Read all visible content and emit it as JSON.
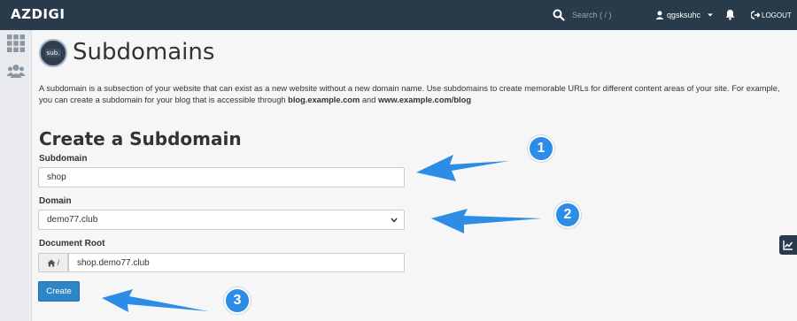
{
  "topbar": {
    "brand": "AZDIGI",
    "search_placeholder": "Search ( / )",
    "username": "qgsksuhc",
    "logout_label": "LOGOUT"
  },
  "header": {
    "logo_text": "sub.",
    "title": "Subdomains"
  },
  "description": {
    "text_1": "A subdomain is a subsection of your website that can exist as a new website without a new domain name. Use subdomains to create memorable URLs for different content areas of your site. For example, you can create a subdomain for your blog that is accessible through ",
    "example_1": "blog.example.com",
    "text_2": " and ",
    "example_2": "www.example.com/blog"
  },
  "form": {
    "title": "Create a Subdomain",
    "subdomain_label": "Subdomain",
    "subdomain_value": "shop",
    "domain_label": "Domain",
    "domain_value": "demo77.club",
    "docroot_label": "Document Root",
    "docroot_prefix": "/",
    "docroot_value": "shop.demo77.club",
    "create_label": "Create"
  },
  "annotations": {
    "badge_1": "1",
    "badge_2": "2",
    "badge_3": "3",
    "arrow_color": "#2d8de6"
  }
}
